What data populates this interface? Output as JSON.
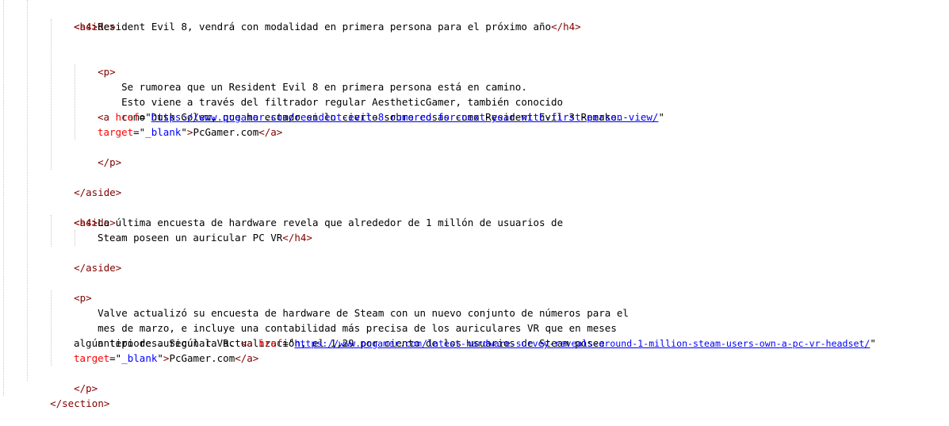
{
  "colors": {
    "tag": "#800000",
    "attribute": "#ff0000",
    "value": "#0000ff",
    "text": "#000000",
    "indent_guide": "#c8c8c8"
  },
  "tokens": {
    "aside_open": "<aside>",
    "aside_close": "</aside>",
    "p_open": "<p>",
    "p_close": "</p>",
    "h4_open": "<h4>",
    "h4_close": "</h4>",
    "a_open": "<a ",
    "a_close": "</a>",
    "section_close": "</section>",
    "href_attr": "href",
    "target_attr": "target",
    "equals": "=\"",
    "quote_close": "\"",
    "tag_end": ">",
    "target_value": "_blank"
  },
  "aside1": {
    "heading": "Resident Evil 8, vendrá con modalidad en primera persona para el próximo año",
    "para_line1": "Se rumorea que un Resident Evil 8 en primera persona está en camino.",
    "para_line2": "Esto viene a través del filtrador regular AestheticGamer, también conocido",
    "para_line3": "como Dusk Golem, que ha estado en lo cierto sobre cosas como Resident Evil 3 Remake.",
    "link_url": "https://www.pcgamer.com/resident-evil-8-rumored-for-next-year-with-first-person-view/",
    "link_text": "PcGamer.com"
  },
  "aside2": {
    "heading_line1": "La última encuesta de hardware revela que alrededor de 1 millón de usuarios de",
    "heading_line2": "Steam poseen un auricular PC VR"
  },
  "paragraph": {
    "line1": "Valve actualizó su encuesta de hardware de Steam con un nuevo conjunto de números para el",
    "line2": "mes de marzo, e incluye una contabilidad más precisa de los auriculares VR que en meses",
    "line3": "anteriores. Según la actualización, el 1,29 por ciento de los usuarios de Steam posee",
    "line4": "algún tipo de auricular VR. ",
    "link_url": "https://www.pcgamer.com/latest-hardware-survey-reveals-around-1-million-steam-users-own-a-pc-vr-headset/",
    "link_text": "PcGamer.com"
  }
}
